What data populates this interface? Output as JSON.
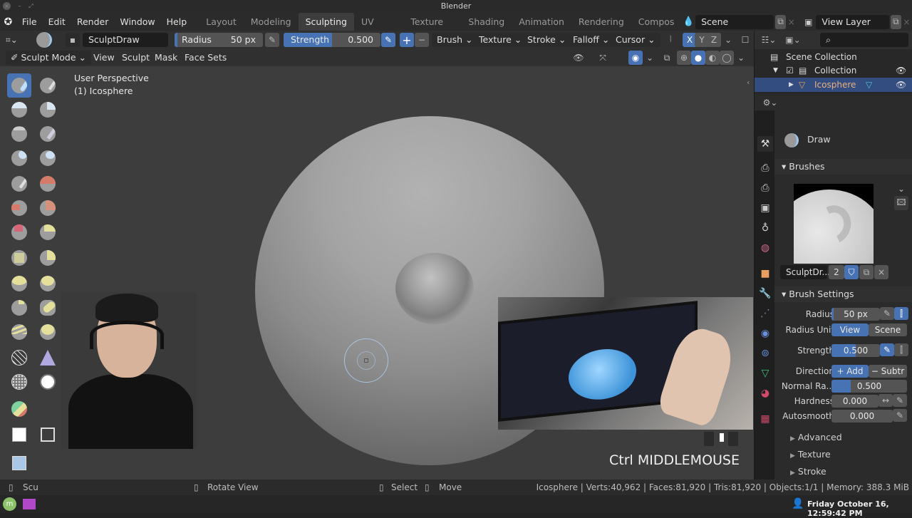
{
  "window": {
    "title": "Blender"
  },
  "menu": [
    "File",
    "Edit",
    "Render",
    "Window",
    "Help"
  ],
  "workspaces": [
    {
      "label": "Layout",
      "active": false
    },
    {
      "label": "Modeling",
      "active": false
    },
    {
      "label": "Sculpting",
      "active": true
    },
    {
      "label": "UV Editing",
      "active": false
    },
    {
      "label": "Texture Paint",
      "active": false
    },
    {
      "label": "Shading",
      "active": false
    },
    {
      "label": "Animation",
      "active": false
    },
    {
      "label": "Rendering",
      "active": false
    },
    {
      "label": "Compos",
      "active": false
    }
  ],
  "scene": {
    "name": "Scene",
    "view_layer": "View Layer"
  },
  "tool_header": {
    "brush_name": "SculptDraw",
    "radius": {
      "label": "Radius",
      "value": "50 px"
    },
    "strength": {
      "label": "Strength",
      "value": "0.500",
      "fraction": 0.5
    },
    "plus": "+",
    "minus": "−",
    "dropdowns": [
      "Brush",
      "Texture",
      "Stroke",
      "Falloff",
      "Cursor"
    ],
    "symmetry": [
      "X",
      "Y",
      "Z"
    ]
  },
  "view_header": {
    "mode": "Sculpt Mode",
    "menus": [
      "View",
      "Sculpt",
      "Mask",
      "Face Sets"
    ]
  },
  "viewport": {
    "overlay_line1": "User Perspective",
    "overlay_line2": "(1) Icosphere",
    "keystroke": "Ctrl MIDDLEMOUSE"
  },
  "outliner": {
    "root": "Scene Collection",
    "collection": "Collection",
    "object": "Icosphere"
  },
  "properties": {
    "tool_name": "Draw",
    "brushes_header": "Brushes",
    "brush_datablock": "SculptDr...",
    "brush_users": "2",
    "brush_settings_header": "Brush Settings",
    "radius": {
      "label": "Radius",
      "value": "50 px"
    },
    "radius_unit": {
      "label": "Radius Unit",
      "options": [
        "View",
        "Scene"
      ],
      "selected": "View"
    },
    "strength": {
      "label": "Strength",
      "value": "0.500",
      "fraction": 0.5
    },
    "direction": {
      "label": "Direction",
      "options": [
        "+ Add",
        "− Subtr"
      ],
      "selected": "+ Add"
    },
    "normal_radius": {
      "label": "Normal Ra...",
      "value": "0.500",
      "fraction": 0.5
    },
    "hardness": {
      "label": "Hardness",
      "value": "0.000"
    },
    "autosmooth": {
      "label": "Autosmooth",
      "value": "0.000"
    },
    "subpanels": [
      "Advanced",
      "Texture",
      "Stroke"
    ]
  },
  "statusbar": {
    "left": "Scu",
    "rotate": "Rotate View",
    "select": "Select",
    "move": "Move",
    "stats": "Icosphere | Verts:40,962 | Faces:81,920 | Tris:81,920 | Objects:1/1 | Memory: 388.3 MiB"
  },
  "taskbar": {
    "clock": "Friday October 16, 12:59:42 PM"
  },
  "colors": {
    "accent": "#4772b3",
    "selected_row": "#334d80",
    "object_orange": "#e8a060"
  }
}
